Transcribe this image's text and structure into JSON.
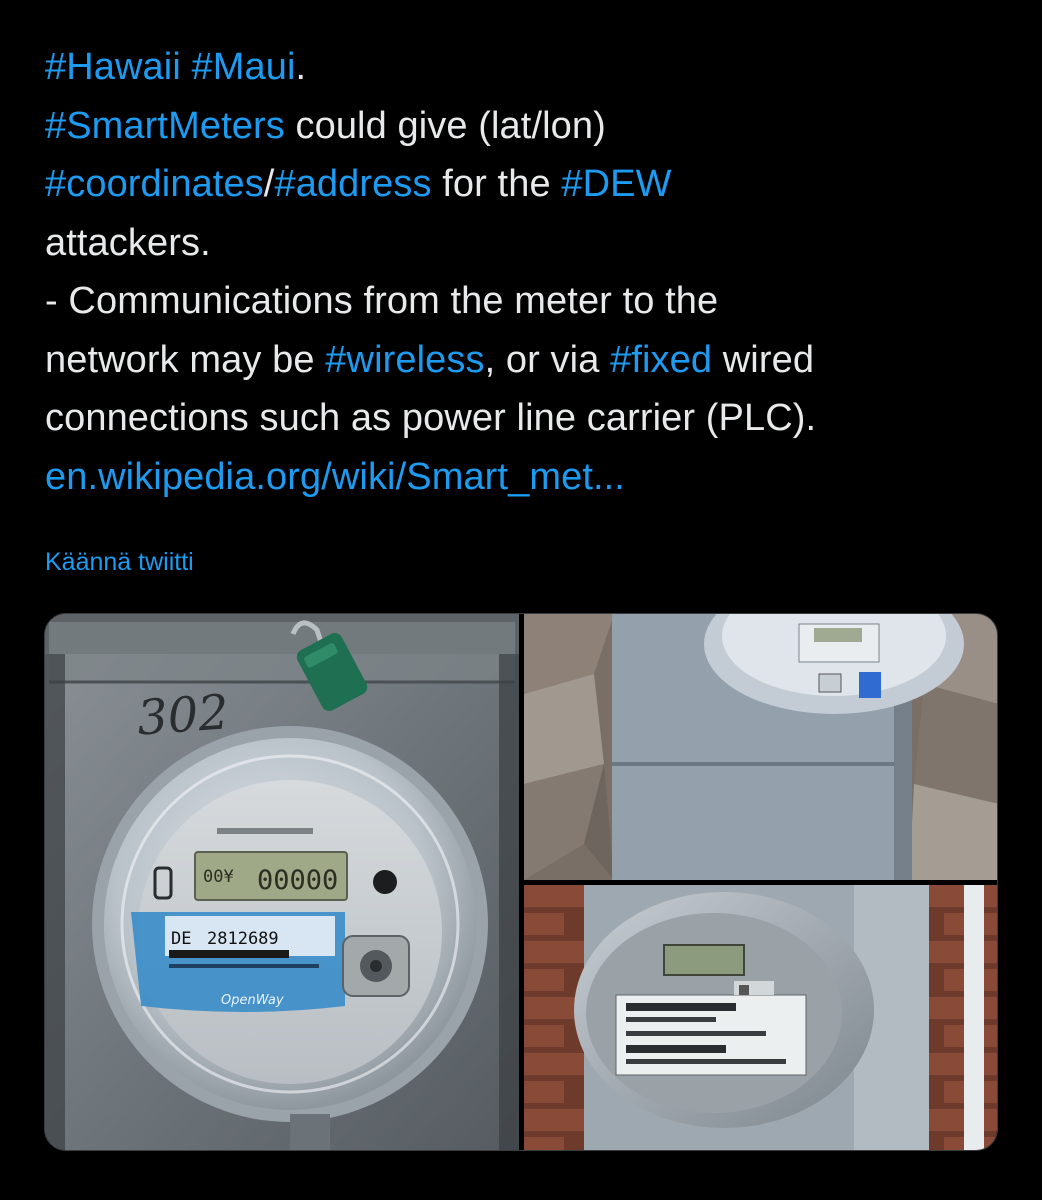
{
  "tweet": {
    "line1": {
      "tag1": "#Hawaii",
      "sep1": " ",
      "tag2": "#Maui",
      "end": "."
    },
    "line2": {
      "tag": "#SmartMeters",
      "text": " could give (lat/lon)"
    },
    "line3": {
      "tag1": "#coordinates",
      "slash": "/",
      "tag2": "#address",
      "text": " for the ",
      "tag3": "#DEW"
    },
    "line4": {
      "text": "attackers."
    },
    "line5": {
      "text": "- Communications from the meter to the"
    },
    "line6": {
      "pre": "network may be ",
      "tag1": "#wireless",
      "mid": ", or via ",
      "tag2": "#fixed",
      "post": " wired"
    },
    "line7": {
      "text": "connections such as power line carrier (PLC)."
    },
    "line8": {
      "url": "en.wikipedia.org/wiki/Smart_met..."
    }
  },
  "translate_label": "Käännä twiitti",
  "meter_photo": {
    "handwritten": "302",
    "lcd_left": "00¥",
    "lcd_main": "00000",
    "serial_prefix": "DE",
    "serial_number": "2812689",
    "brand": "OpenWay"
  },
  "colors": {
    "background": "#000000",
    "text": "#e7e9ea",
    "link": "#1d9bf0"
  }
}
